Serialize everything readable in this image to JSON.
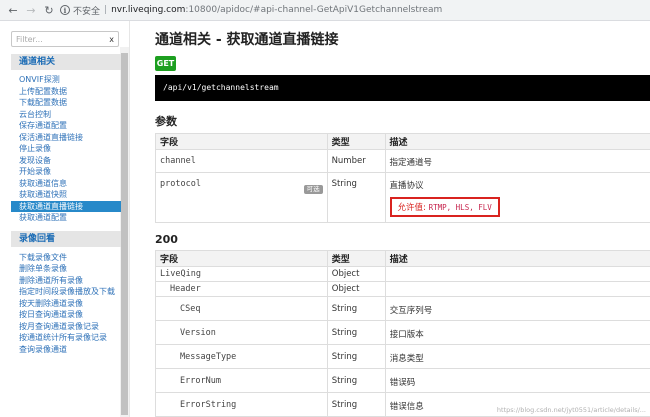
{
  "browser": {
    "back_icon": "back-arrow-icon",
    "forward_icon": "forward-arrow-icon",
    "reload_icon": "reload-icon",
    "security_label": "不安全",
    "url_host": "nvr.liveqing.com",
    "url_rest": ":10800/apidoc/#api-channel-GetApiV1Getchannelstream"
  },
  "sidebar": {
    "filter_placeholder": "Filter...",
    "filter_clear": "x",
    "groups": [
      {
        "title": "通道相关",
        "items": [
          "ONVIF探测",
          "上传配置数据",
          "下载配置数据",
          "云台控制",
          "保存通道配置",
          "保活通道直播链接",
          "停止录像",
          "发现设备",
          "开始录像",
          "获取通道信息",
          "获取通道快照",
          "获取通道直播链接",
          "获取通道配置"
        ],
        "active_index": 11
      },
      {
        "title": "录像回看",
        "items": [
          "下载录像文件",
          "删除单条录像",
          "删除通道所有录像",
          "指定时间段录像播放及下载",
          "按天删除通道录像",
          "按日查询通道录像",
          "按月查询通道录像记录",
          "按通道统计所有录像记录",
          "查询录像通道"
        ]
      }
    ]
  },
  "main": {
    "title": "通道相关 - 获取通道直播链接",
    "method": "GET",
    "endpoint": "/api/v1/getchannelstream",
    "params_title": "参数",
    "params_headers": [
      "字段",
      "类型",
      "描述"
    ],
    "params_rows": [
      {
        "field": "channel",
        "type": "Number",
        "desc": "指定通道号"
      },
      {
        "field": "protocol",
        "type": "String",
        "desc": "直播协议",
        "tag": "可选",
        "allowed_label": "允许值:",
        "allowed_values": "RTMP, HLS, FLV"
      }
    ],
    "response_title": "200",
    "response_headers": [
      "字段",
      "类型",
      "描述"
    ],
    "response_rows": [
      {
        "field": "LiveQing",
        "type": "Object",
        "desc": "",
        "indent": 0
      },
      {
        "field": "Header",
        "type": "Object",
        "desc": "",
        "indent": 1
      },
      {
        "field": "CSeq",
        "type": "String",
        "desc": "交互序列号",
        "indent": 2
      },
      {
        "field": "Version",
        "type": "String",
        "desc": "接口版本",
        "indent": 2
      },
      {
        "field": "MessageType",
        "type": "String",
        "desc": "消息类型",
        "indent": 2
      },
      {
        "field": "ErrorNum",
        "type": "String",
        "desc": "错误码",
        "indent": 2
      },
      {
        "field": "ErrorString",
        "type": "String",
        "desc": "错误信息",
        "indent": 2
      }
    ],
    "watermark": "https://blog.csdn.net/jyt0551/article/details/..."
  },
  "colors": {
    "accent": "#2789c9",
    "get_badge": "#1d9f20",
    "highlight_box": "#d9231f"
  }
}
